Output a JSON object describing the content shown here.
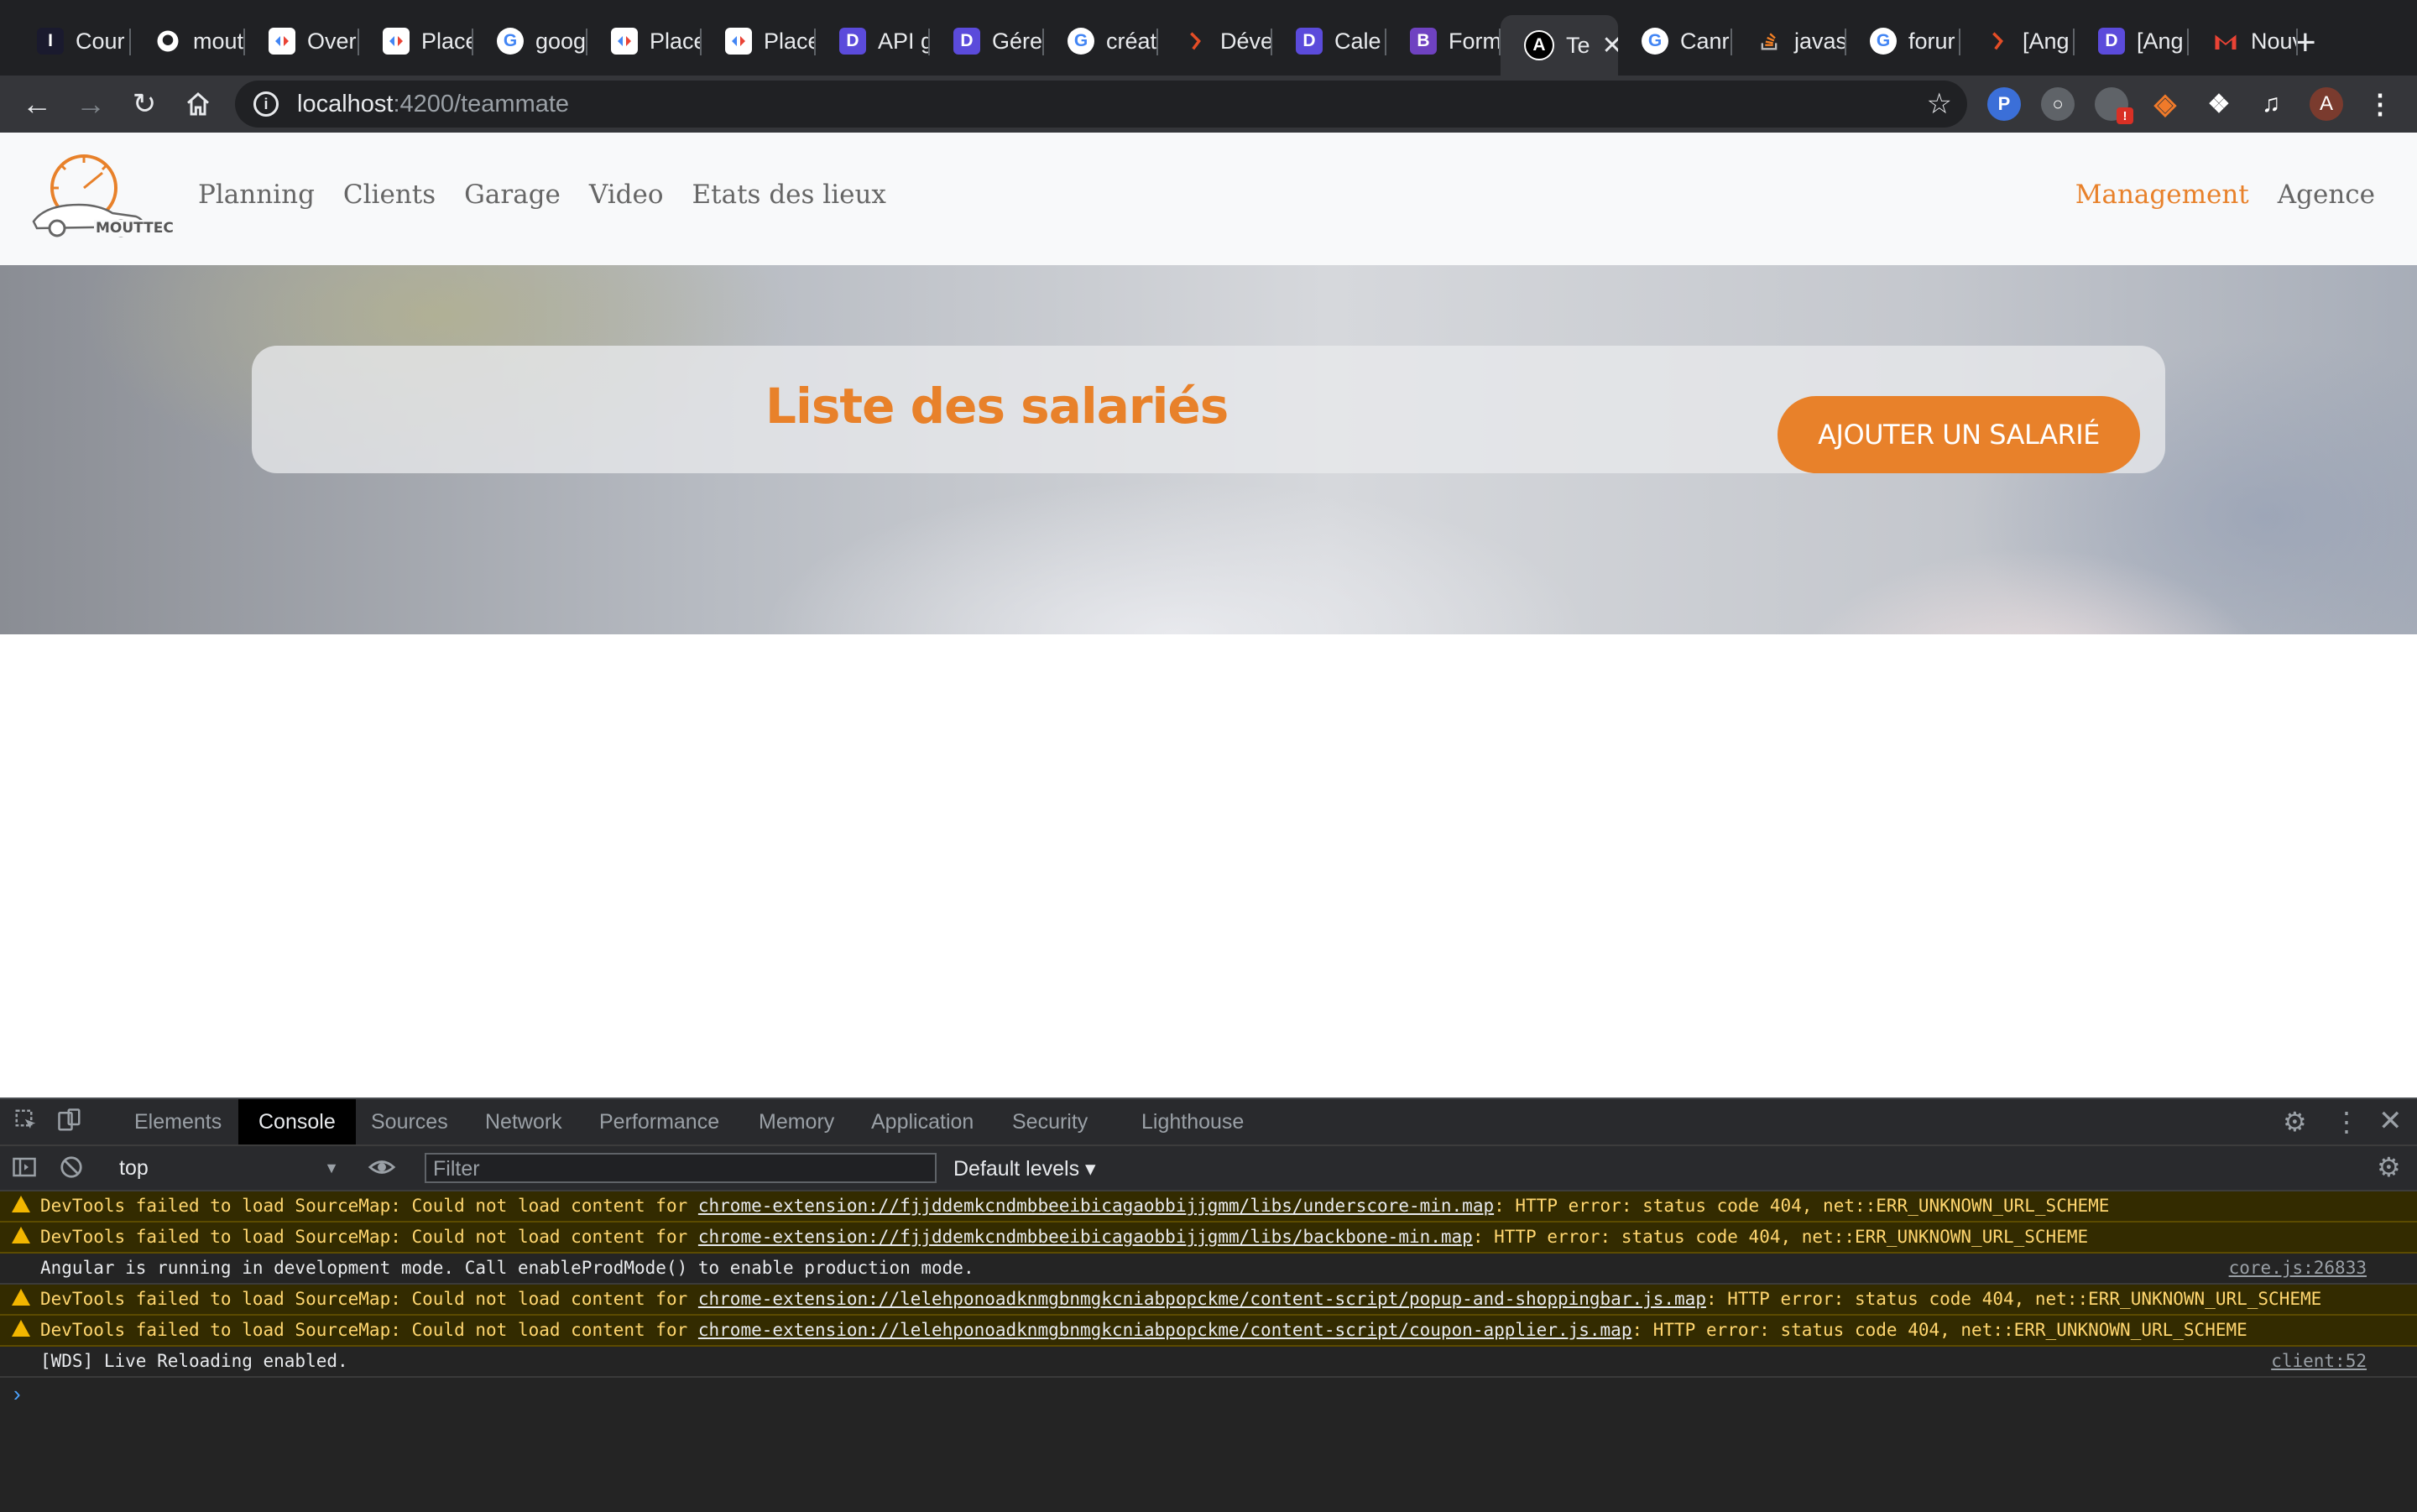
{
  "browser": {
    "tabs": [
      {
        "label": "Cour",
        "fav": "I",
        "favColor": "#1a1a2e"
      },
      {
        "label": "mout",
        "fav": "gh",
        "favColor": "#ffffff"
      },
      {
        "label": "Over",
        "fav": "gd",
        "favColor": "#ffffff"
      },
      {
        "label": "Place",
        "fav": "gd",
        "favColor": "#ffffff"
      },
      {
        "label": "goog",
        "fav": "G",
        "favColor": "#ffffff"
      },
      {
        "label": "Place",
        "fav": "gd",
        "favColor": "#ffffff"
      },
      {
        "label": "Place",
        "fav": "gd",
        "favColor": "#ffffff"
      },
      {
        "label": "API g",
        "fav": "D",
        "favColor": "#5b4bdb"
      },
      {
        "label": "Gére",
        "fav": "D",
        "favColor": "#5b4bdb"
      },
      {
        "label": "créat",
        "fav": "G",
        "favColor": "#ffffff"
      },
      {
        "label": "Déve",
        "fav": "S",
        "favColor": "#202124"
      },
      {
        "label": "Cale",
        "fav": "D",
        "favColor": "#5b4bdb"
      },
      {
        "label": "Form",
        "fav": "B",
        "favColor": "#6f42c1"
      },
      {
        "label": "Te",
        "fav": "A",
        "favColor": "#000000",
        "active": true
      },
      {
        "label": "Canr",
        "fav": "G",
        "favColor": "#ffffff"
      },
      {
        "label": "javas",
        "fav": "so",
        "favColor": "#202124"
      },
      {
        "label": "forur",
        "fav": "G",
        "favColor": "#ffffff"
      },
      {
        "label": "[Ang",
        "fav": "S",
        "favColor": "#202124"
      },
      {
        "label": "[Ang",
        "fav": "D",
        "favColor": "#5b4bdb"
      },
      {
        "label": "Nouv",
        "fav": "M",
        "favColor": "#ffffff"
      }
    ],
    "url_host": "localhost",
    "url_rest": ":4200/teammate",
    "profile_initial": "A"
  },
  "app": {
    "brand": "MOUTTEC",
    "nav_left": [
      "Planning",
      "Clients",
      "Garage",
      "Video",
      "Etats des lieux"
    ],
    "nav_right": [
      "Management",
      "Agence"
    ],
    "active_nav": "Management",
    "accent": "#e8812a",
    "page_title": "Liste des salariés",
    "add_button": "AJOUTER UN SALARIÉ"
  },
  "devtools": {
    "tabs": [
      "Elements",
      "Console",
      "Sources",
      "Network",
      "Performance",
      "Memory",
      "Application",
      "Security",
      "Lighthouse"
    ],
    "active_tab": "Console",
    "context": "top",
    "filter_placeholder": "Filter",
    "levels": "Default levels",
    "messages": [
      {
        "type": "warn",
        "pre": "DevTools failed to load SourceMap: Could not load content for ",
        "link": "chrome-extension://fjjddemkcndmbbeeibicagaobbijjgmm/libs/underscore-min.map",
        "post": ": HTTP error: status code 404, net::ERR_UNKNOWN_URL_SCHEME",
        "src": ""
      },
      {
        "type": "warn",
        "pre": "DevTools failed to load SourceMap: Could not load content for ",
        "link": "chrome-extension://fjjddemkcndmbbeeibicagaobbijjgmm/libs/backbone-min.map",
        "post": ": HTTP error: status code 404, net::ERR_UNKNOWN_URL_SCHEME",
        "src": ""
      },
      {
        "type": "log",
        "pre": "Angular is running in development mode. Call enableProdMode() to enable production mode.",
        "link": "",
        "post": "",
        "src": "core.js:26833"
      },
      {
        "type": "warn",
        "pre": "DevTools failed to load SourceMap: Could not load content for ",
        "link": "chrome-extension://lelehponoadknmgbnmgkcniabpopckme/content-script/popup-and-shoppingbar.js.map",
        "post": ": HTTP error: status code 404, net::ERR_UNKNOWN_URL_SCHEME",
        "src": ""
      },
      {
        "type": "warn",
        "pre": "DevTools failed to load SourceMap: Could not load content for ",
        "link": "chrome-extension://lelehponoadknmgbnmgkcniabpopckme/content-script/coupon-applier.js.map",
        "post": ": HTTP error: status code 404, net::ERR_UNKNOWN_URL_SCHEME",
        "src": ""
      },
      {
        "type": "log",
        "pre": "[WDS] Live Reloading enabled.",
        "link": "",
        "post": "",
        "src": "client:52"
      }
    ]
  }
}
